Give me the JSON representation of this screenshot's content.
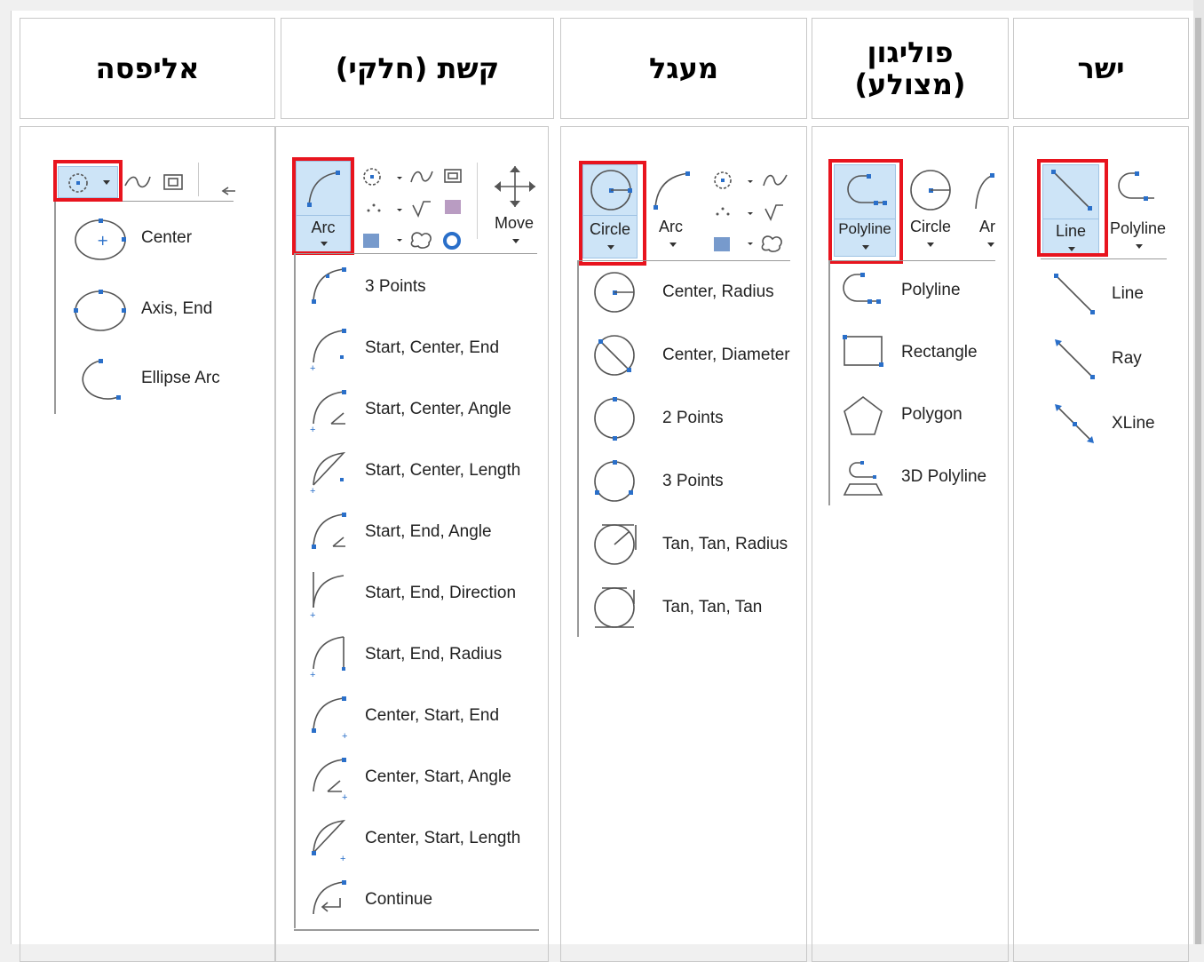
{
  "columns": {
    "ellipse": {
      "header": "אליפסה",
      "items": [
        "Center",
        "Axis, End",
        "Ellipse Arc"
      ]
    },
    "arc": {
      "header": "קשת (חלקי)",
      "button_label": "Arc",
      "move_label": "Move",
      "items": [
        "3 Points",
        "Start, Center, End",
        "Start, Center, Angle",
        "Start, Center, Length",
        "Start, End, Angle",
        "Start, End, Direction",
        "Start, End, Radius",
        "Center, Start,  End",
        "Center, Start,  Angle",
        "Center, Start, Length",
        "Continue"
      ]
    },
    "circle": {
      "header": "מעגל",
      "button_label": "Circle",
      "arc_label": "Arc",
      "items": [
        "Center, Radius",
        "Center, Diameter",
        "2 Points",
        "3 Points",
        "Tan, Tan, Radius",
        "Tan, Tan, Tan"
      ]
    },
    "polygon": {
      "header": "פוליגון (מצולע)",
      "button_label": "Polyline",
      "circle_label": "Circle",
      "arc_partial_label": "Ar",
      "items": [
        "Polyline",
        "Rectangle",
        "Polygon",
        "3D Polyline"
      ]
    },
    "line": {
      "header": "ישר",
      "button_label": "Line",
      "polyline_partial_label": "Polyline",
      "items": [
        "Line",
        "Ray",
        "XLine"
      ]
    }
  },
  "colors": {
    "highlight_red": "#e8141e",
    "ribbon_blue": "#cde4f7",
    "grip_blue": "#2a6fc9"
  }
}
